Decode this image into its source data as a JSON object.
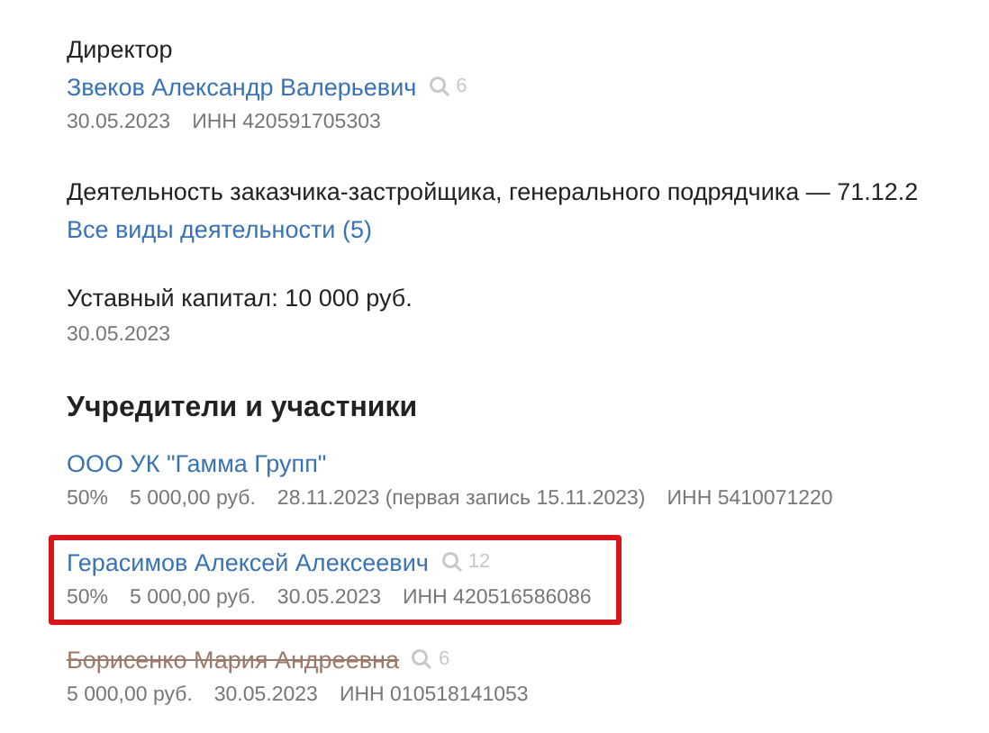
{
  "director": {
    "label": "Директор",
    "name": "Звеков Александр Валерьевич",
    "count": "6",
    "meta": [
      "30.05.2023",
      "ИНН 420591705303"
    ]
  },
  "activity": {
    "text": "Деятельность заказчика-застройщика, генерального подрядчика — 71.12.2",
    "link": "Все виды деятельности (5)"
  },
  "capital": {
    "text": "Уставный капитал: 10 000 руб.",
    "date": "30.05.2023"
  },
  "founders": {
    "title": "Учредители и участники",
    "items": [
      {
        "name": "ООО УК \"Гамма Групп\"",
        "struck": false,
        "highlighted": false,
        "meta": [
          "50%",
          "5 000,00 руб.",
          "28.11.2023 (первая запись 15.11.2023)",
          "ИНН 5410071220"
        ]
      },
      {
        "name": "Герасимов Алексей Алексеевич",
        "count": "12",
        "struck": false,
        "highlighted": true,
        "meta": [
          "50%",
          "5 000,00 руб.",
          "30.05.2023",
          "ИНН 420516586086"
        ]
      },
      {
        "name": "Борисенко Мария Андреевна",
        "count": "6",
        "struck": true,
        "highlighted": false,
        "meta": [
          "5 000,00 руб.",
          "30.05.2023",
          "ИНН 010518141053"
        ]
      }
    ]
  }
}
